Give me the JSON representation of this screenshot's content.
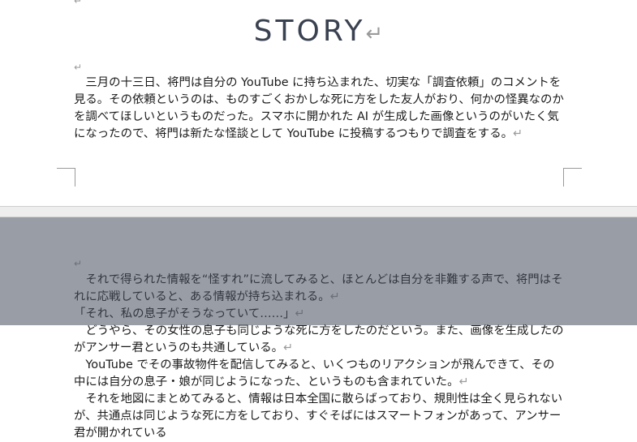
{
  "title": "STORY",
  "para_mark": "↵",
  "page1": {
    "paragraph": "　三月の十三日、将門は自分の YouTube に持ち込まれた、切実な「調査依頼」のコメントを見る。その依頼というのは、ものすごくおかしな死に方をした友人がおり、何かの怪異なのかを調べてほしいというものだった。スマホに開かれた AI が生成した画像というのがいたく気になったので、将門は新たな怪談として YouTube に投稿するつもりで調査をする。"
  },
  "page2": {
    "paragraphs": [
      "　それで得られた情報を“怪すれ”に流してみると、ほとんどは自分を非難する声で、将門はそれに応戦していると、ある情報が持ち込まれる。",
      "「それ、私の息子がそうなっていて……」",
      "　どうやら、その女性の息子も同じような死に方をしたのだという。また、画像を生成したのがアンサー君というのも共通している。",
      "　YouTube でその事故物件を配信してみると、いくつものリアクションが飛んできて、その中には自分の息子・娘が同じようになった、というものも含まれていた。",
      "　それを地図にまとめてみると、情報は日本全国に散らばっており、規則性は全く見られないが、共通点は同じような死に方をしており、すぐそばにはスマートフォンがあって、アンサー君が開かれている"
    ]
  }
}
